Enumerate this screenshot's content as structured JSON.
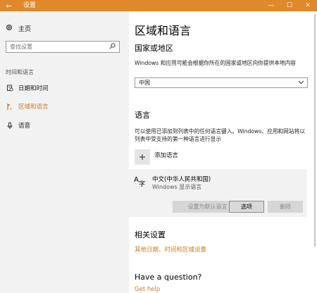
{
  "window": {
    "title": "设置",
    "back_icon": "←",
    "minimize_icon": "—",
    "maximize_icon": "☐",
    "close_icon": "✕",
    "accent": "#e0892a"
  },
  "sidebar": {
    "home_label": "主页",
    "search_placeholder": "查找设置",
    "section_label": "时间和语言",
    "items": [
      {
        "label": "日期和时间",
        "icon": "calendar-clock-icon",
        "active": false
      },
      {
        "label": "区域和语言",
        "icon": "region-language-icon",
        "active": true
      },
      {
        "label": "语音",
        "icon": "microphone-icon",
        "active": false
      }
    ]
  },
  "main": {
    "title": "区域和语言",
    "country": {
      "heading": "国家或地区",
      "description": "Windows 和应用可能会根据你所在的国家或地区向你提供本地内容",
      "selected": "中国"
    },
    "language": {
      "heading": "语言",
      "description": "可以使用已添加到列表中的任何语言键入。Windows、应用和网站将以列表中受支持的第一种语言进行显示",
      "add_label": "添加语言",
      "items": [
        {
          "name": "中文(中华人民共和国)",
          "subtitle": "Windows 显示语言",
          "buttons": {
            "set_default": "设置为默认语言",
            "options": "选项",
            "remove": "删除"
          }
        }
      ]
    },
    "related": {
      "heading": "相关设置",
      "link": "其他日期、时间和区域设置"
    },
    "question": {
      "heading": "Have a question?",
      "link": "Get help"
    },
    "link_color": "#d07a1e"
  }
}
